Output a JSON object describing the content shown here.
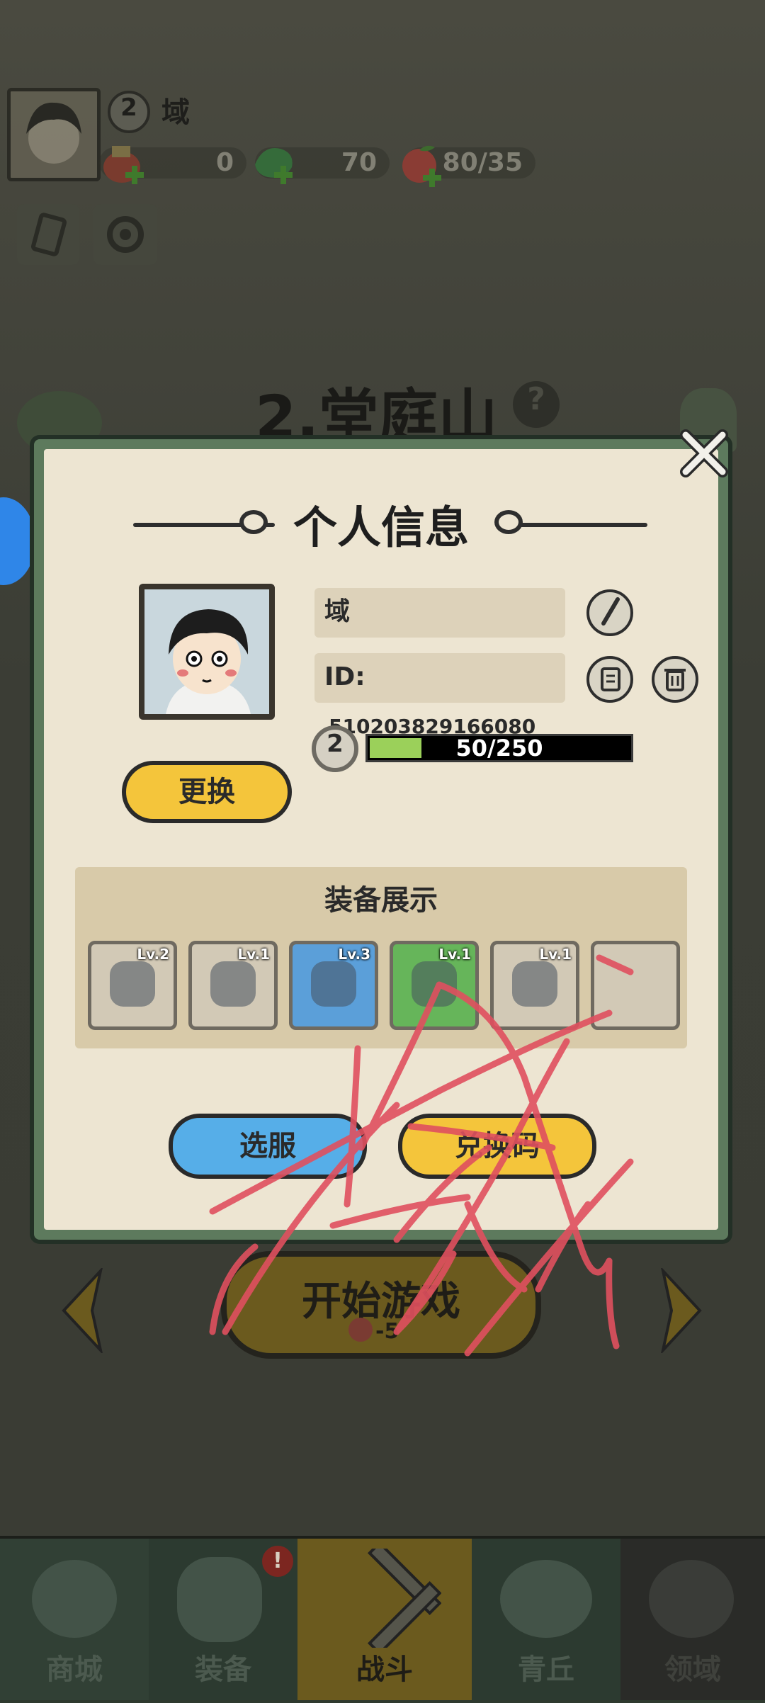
{
  "player": {
    "level": "2",
    "name": "域"
  },
  "resources": [
    {
      "icon": "gold-pouch-icon",
      "value": "0"
    },
    {
      "icon": "jade-dragon-icon",
      "value": "70"
    },
    {
      "icon": "peach-icon",
      "value": "80/35"
    }
  ],
  "stage": {
    "title": "2.堂庭山"
  },
  "start_button": {
    "label": "开始游戏",
    "cost": "-5"
  },
  "bottom_nav": [
    {
      "label": "商城",
      "icon": "shop-icon"
    },
    {
      "label": "装备",
      "icon": "helmet-icon",
      "badge": "!"
    },
    {
      "label": "战斗",
      "icon": "crossed-swords-icon",
      "active": true
    },
    {
      "label": "青丘",
      "icon": "mountain-icon"
    },
    {
      "label": "领域",
      "icon": "portal-icon"
    }
  ],
  "modal": {
    "title": "个人信息",
    "name_value": "域",
    "id_label": "ID:",
    "id_value": "510203829166080",
    "level": "2",
    "exp_text": "50/250",
    "exp_progress": 0.2,
    "change_button": "更换",
    "equipment_title": "装备展示",
    "equipment": [
      {
        "level": "Lv.2",
        "icon": "golden-branch-icon",
        "bg": "#d2c9b6"
      },
      {
        "level": "Lv.1",
        "icon": "ice-armor-icon",
        "bg": "#d2c9b6"
      },
      {
        "level": "Lv.3",
        "icon": "ice-claw-icon",
        "bg": "#5b9fd9"
      },
      {
        "level": "Lv.1",
        "icon": "ice-bracer-icon",
        "bg": "#66b55a"
      },
      {
        "level": "Lv.1",
        "icon": "boots-icon",
        "bg": "#d2c9b6"
      },
      {
        "level": "",
        "icon": "empty-slot",
        "bg": "#d2c9b6"
      }
    ],
    "server_button": "选服",
    "redeem_button": "兑换码"
  },
  "colors": {
    "accent_yellow": "#f4c53b",
    "accent_blue": "#56aee8",
    "exp_green": "#9bd05a",
    "scribble": "#e0505f"
  }
}
